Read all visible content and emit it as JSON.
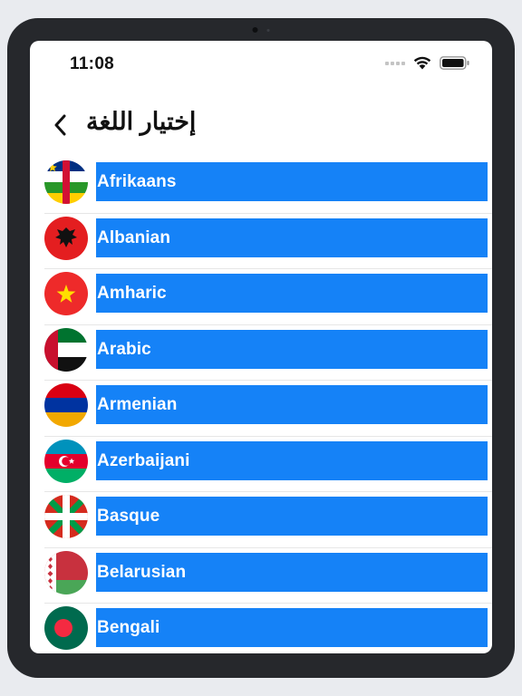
{
  "status": {
    "time": "11:08"
  },
  "header": {
    "title": "إختيار اللغة",
    "back_icon": "chevron-left-icon"
  },
  "colors": {
    "accent": "#1582f7",
    "text": "#111111",
    "bezel": "#26282c"
  },
  "languages": [
    {
      "label": "Afrikaans",
      "flag_icon": "flag-central-african-republic-icon"
    },
    {
      "label": "Albanian",
      "flag_icon": "flag-albania-icon"
    },
    {
      "label": "Amharic",
      "flag_icon": "flag-ethiopia-icon"
    },
    {
      "label": "Arabic",
      "flag_icon": "flag-uae-icon"
    },
    {
      "label": "Armenian",
      "flag_icon": "flag-armenia-icon"
    },
    {
      "label": "Azerbaijani",
      "flag_icon": "flag-azerbaijan-icon"
    },
    {
      "label": "Basque",
      "flag_icon": "flag-basque-icon"
    },
    {
      "label": "Belarusian",
      "flag_icon": "flag-belarus-icon"
    },
    {
      "label": "Bengali",
      "flag_icon": "flag-bangladesh-icon"
    }
  ]
}
